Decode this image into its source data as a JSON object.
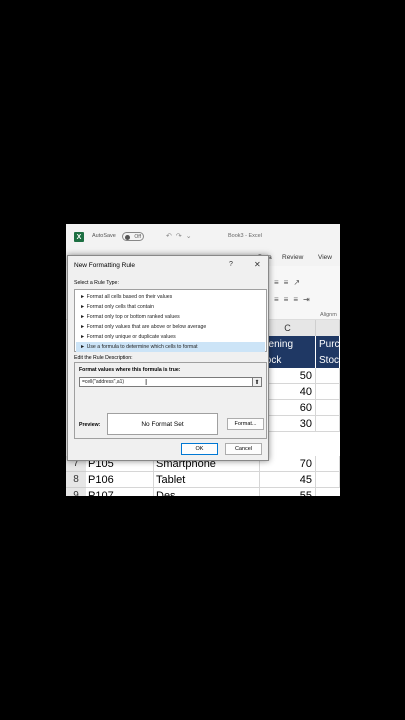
{
  "excel": {
    "logo": "X",
    "autosave_label": "AutoSave",
    "toggle_label": "Off",
    "doc_title": "Book3 - Excel",
    "ribbon_tabs": [
      "Data",
      "Review",
      "View"
    ],
    "ribbon_group_label": "Alignm"
  },
  "grid": {
    "col_headers": [
      "C"
    ],
    "header_row": [
      {
        "line1": "pening",
        "line2": "tock"
      },
      {
        "line1": "Purc",
        "line2": "Stoc"
      }
    ],
    "visible_values": [
      "50",
      "40",
      "60",
      "30"
    ],
    "rows": [
      {
        "num": "7",
        "id": "P105",
        "name": "Smartphone",
        "value": "70"
      },
      {
        "num": "8",
        "id": "P106",
        "name": "Tablet",
        "value": "45"
      },
      {
        "num": "9",
        "id": "P107",
        "name": "Des",
        "value": "55"
      }
    ],
    "header_color": "#1f3864"
  },
  "dialog": {
    "title": "New Formatting Rule",
    "help": "?",
    "close": "✕",
    "select_rule_label": "Select a Rule Type:",
    "rules": [
      "► Format all cells based on their values",
      "► Format only cells that contain",
      "► Format only top or bottom ranked values",
      "► Format only values that are above or below average",
      "► Format only unique or duplicate values",
      "► Use a formula to determine which cells to format"
    ],
    "selected_rule_index": 5,
    "edit_rule_label": "Edit the Rule Description:",
    "formula_label": "Format values where this formula is true:",
    "formula_value": "=cell(\"address\",a1)",
    "preview_label": "Preview:",
    "preview_text": "No Format Set",
    "format_button": "Format...",
    "ok_button": "OK",
    "cancel_button": "Cancel"
  }
}
